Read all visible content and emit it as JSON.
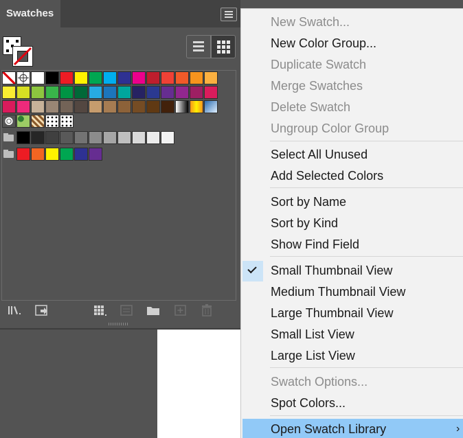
{
  "panel": {
    "tab_label": "Swatches",
    "swatch_rows": [
      [
        "#ffffff",
        "#ffffff",
        "#ffffff",
        "#000000",
        "#ed1c24",
        "#fff200",
        "#00a651",
        "#00aeef",
        "#2e3192",
        "#ec008c",
        "#be1e2d",
        "#ef4136",
        "#f15a29",
        "#f7941d",
        "#fbb040"
      ],
      [
        "#f9ed32",
        "#d7df23",
        "#8dc63f",
        "#39b54a",
        "#009444",
        "#006838",
        "#27aae1",
        "#1c75bc",
        "#00a79d",
        "#262262",
        "#2b3990",
        "#662d91",
        "#92278f",
        "#9e1f63",
        "#da1c5c"
      ],
      [
        "#d91b5c",
        "#ee2a7b",
        "#c7b299",
        "#998675",
        "#736357",
        "#534741",
        "#c69c6d",
        "#a67c52",
        "#8c6239",
        "#754c24",
        "#603913",
        "#42210b",
        "#cccccc",
        "#fbb040",
        "#8cc7ec"
      ],
      [
        "#dcdcdc",
        "#7cc576",
        "#a67c52",
        "#ffffff",
        "#ffffff"
      ],
      [
        "#000000",
        "#262626",
        "#404040",
        "#595959",
        "#737373",
        "#8c8c8c",
        "#a6a6a6",
        "#bfbfbf",
        "#d9d9d9",
        "#ececec",
        "#f2f2f2"
      ],
      [
        "#ed1c24",
        "#f26522",
        "#fff200",
        "#00a651",
        "#2e3192",
        "#662d91"
      ]
    ]
  },
  "menu": {
    "items": [
      {
        "label": "New Swatch...",
        "enabled": false
      },
      {
        "label": "New Color Group...",
        "enabled": true
      },
      {
        "label": "Duplicate Swatch",
        "enabled": false
      },
      {
        "label": "Merge Swatches",
        "enabled": false
      },
      {
        "label": "Delete Swatch",
        "enabled": false
      },
      {
        "label": "Ungroup Color Group",
        "enabled": false
      },
      {
        "label": "Select All Unused",
        "enabled": true
      },
      {
        "label": "Add Selected Colors",
        "enabled": true
      },
      {
        "label": "Sort by Name",
        "enabled": true
      },
      {
        "label": "Sort by Kind",
        "enabled": true
      },
      {
        "label": "Show Find Field",
        "enabled": true
      },
      {
        "label": "Small Thumbnail View",
        "enabled": true,
        "checked": true
      },
      {
        "label": "Medium Thumbnail View",
        "enabled": true
      },
      {
        "label": "Large Thumbnail View",
        "enabled": true
      },
      {
        "label": "Small List View",
        "enabled": true
      },
      {
        "label": "Large List View",
        "enabled": true
      },
      {
        "label": "Swatch Options...",
        "enabled": false
      },
      {
        "label": "Spot Colors...",
        "enabled": true
      },
      {
        "label": "Open Swatch Library",
        "enabled": true,
        "submenu": true,
        "highlighted": true
      }
    ],
    "submenu_arrow": "›",
    "checkmark_icon": "checkmark-icon"
  },
  "colors": {
    "panel_bg": "#535353",
    "menu_bg": "#f2f2f2",
    "highlight": "#91c9f7",
    "check_bg": "#cce4f7"
  }
}
